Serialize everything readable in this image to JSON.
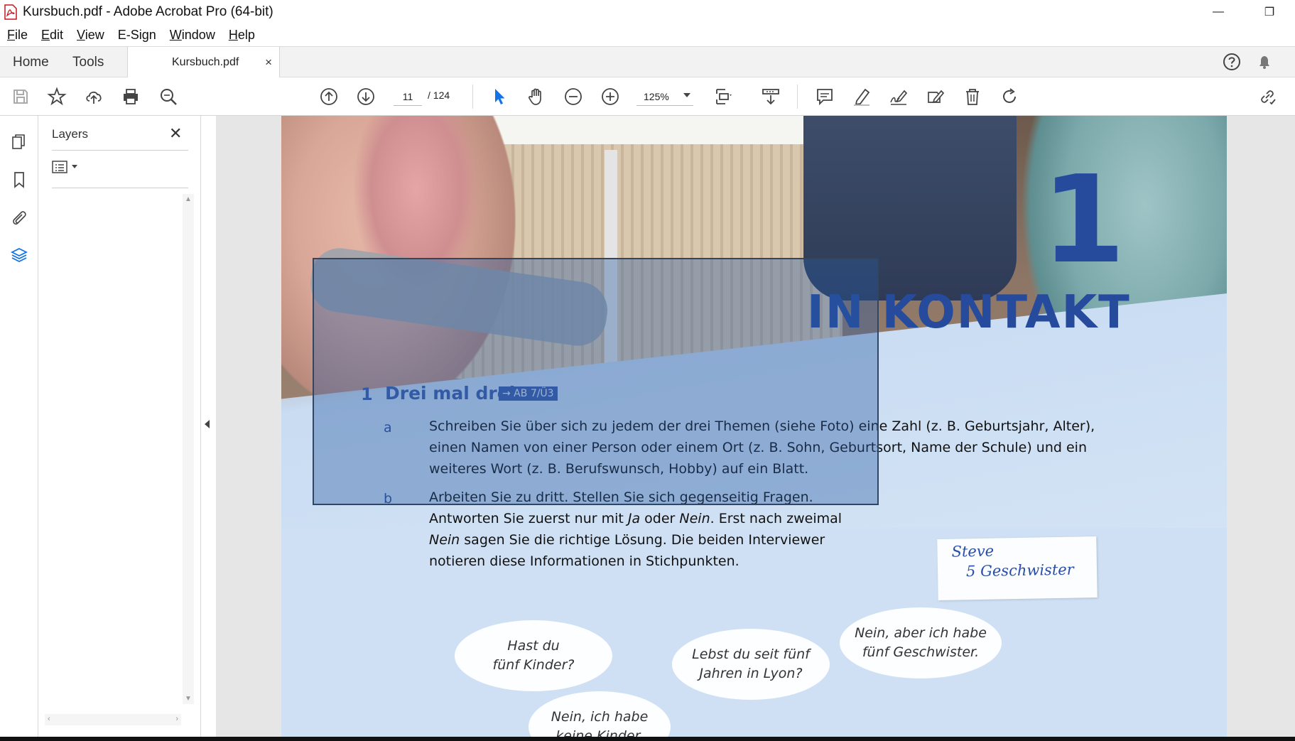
{
  "window": {
    "title": "Kursbuch.pdf - Adobe Acrobat Pro (64-bit)",
    "minimize_glyph": "—",
    "restore_glyph": "❐"
  },
  "menu": {
    "items": [
      {
        "label": "File",
        "key": "F",
        "rest": "ile"
      },
      {
        "label": "Edit",
        "key": "E",
        "rest": "dit"
      },
      {
        "label": "View",
        "key": "V",
        "rest": "iew"
      },
      {
        "label": "E-Sign",
        "key": "",
        "rest": "E-Sign"
      },
      {
        "label": "Window",
        "key": "W",
        "rest": "indow"
      },
      {
        "label": "Help",
        "key": "H",
        "rest": "elp"
      }
    ]
  },
  "tabs": {
    "home": "Home",
    "tools": "Tools",
    "document": "Kursbuch.pdf",
    "close_glyph": "×"
  },
  "toolbar": {
    "current_page": "11",
    "page_total": "/  124",
    "zoom": "125%",
    "icons": [
      "save-icon",
      "bookmark-star-icon",
      "upload-cloud-icon",
      "print-icon",
      "find-zoom-icon",
      "previous-page-icon",
      "next-page-icon",
      "select-pointer-icon",
      "hand-tool-icon",
      "zoom-out-icon",
      "zoom-in-icon",
      "page-fit-icon",
      "scroll-mode-icon",
      "comment-icon",
      "highlight-icon",
      "sign-icon",
      "edit-pdf-icon",
      "delete-icon",
      "rotate-icon",
      "share-link-icon"
    ]
  },
  "layers_panel": {
    "title": "Layers",
    "close_glyph": "✕"
  },
  "pdf": {
    "chapter_number": "1",
    "chapter_title": "IN KONTAKT",
    "exercise": {
      "number": "1",
      "title": "Drei mal drei!",
      "ref": "→ AB 7/Ü3",
      "a_letter": "a",
      "a_lines": [
        "Schreiben Sie über sich zu jedem der drei Themen (siehe Foto) eine Zahl (z. B. Geburtsjahr, Alter),",
        "einen Namen von einer Person oder einem Ort (z. B. Sohn, Geburtsort, Name der Schule) und ein",
        "weiteres Wort (z. B. Berufswunsch, Hobby) auf ein Blatt."
      ],
      "b_letter": "b",
      "b_line1": "Arbeiten Sie zu dritt. Stellen Sie sich gegenseitig Fragen.",
      "b_line2_pre": "Antworten Sie zuerst nur mit ",
      "b_line2_ja": "Ja",
      "b_line2_mid": " oder ",
      "b_line2_nein": "Nein",
      "b_line2_post": ". Erst nach zweimal",
      "b_line3_nein": "Nein",
      "b_line3_post": " sagen Sie die richtige Lösung. Die beiden Interviewer",
      "b_line4": "notieren diese Informationen in Stichpunkten."
    },
    "note": {
      "line1": "Steve",
      "line2": "5 Geschwister"
    },
    "bubbles": [
      {
        "line1": "Hast du",
        "line2": "fünf Kinder?"
      },
      {
        "line1": "Lebst du seit fünf",
        "line2": "Jahren in Lyon?"
      },
      {
        "line1": "Nein, aber ich habe",
        "line2": "fünf Geschwister."
      },
      {
        "line1": "Nein, ich habe",
        "line2": "keine Kinder."
      }
    ]
  },
  "colors": {
    "accent_blue": "#264b9c",
    "selection": "#285aa0",
    "toolbar_active": "#1473e6"
  }
}
